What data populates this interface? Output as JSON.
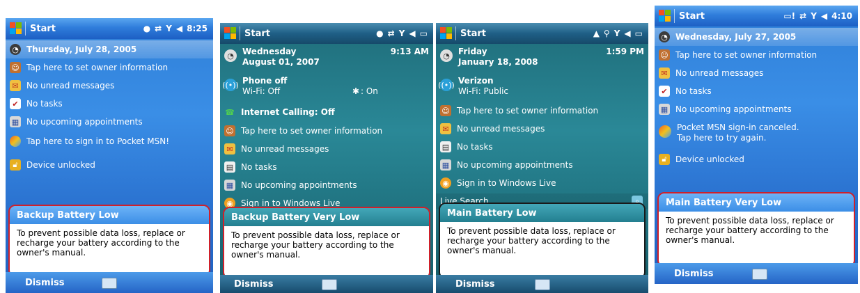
{
  "phones": [
    {
      "titlebar": {
        "start": "Start",
        "time": "8:25"
      },
      "date": "Thursday, July 28, 2005",
      "rows": [
        "Tap here to set owner information",
        "No unread messages",
        "No tasks",
        "No upcoming appointments",
        "Tap here to sign in to Pocket MSN!",
        "Device unlocked"
      ],
      "popup": {
        "title": "Backup Battery Low",
        "body": "To prevent possible data loss, replace or recharge your battery according to the owner's manual."
      },
      "softkey": "Dismiss"
    },
    {
      "titlebar": {
        "start": "Start"
      },
      "date_line1": "Wednesday",
      "date_line2": "August 01, 2007",
      "time": "9:13 AM",
      "phone_title": "Phone off",
      "phone_sub": "Wi-Fi: Off",
      "bluetooth": ": On",
      "internet": "Internet Calling: Off",
      "rows": [
        "Tap here to set owner information",
        "No unread messages",
        "No tasks",
        "No upcoming appointments",
        "Sign in to Windows Live"
      ],
      "popup": {
        "title": "Backup Battery Very Low",
        "body": "To prevent possible data loss, replace or recharge your battery according to the owner's manual."
      },
      "softkey": "Dismiss"
    },
    {
      "titlebar": {
        "start": "Start"
      },
      "date_line1": "Friday",
      "date_line2": "January 18, 2008",
      "time": "1:59 PM",
      "carrier": "Verizon",
      "wifi": "Wi-Fi: Public",
      "rows": [
        "Tap here to set owner information",
        "No unread messages",
        "No tasks",
        "No upcoming appointments",
        "Sign in to Windows Live"
      ],
      "search": "Live Search",
      "popup": {
        "title": "Main Battery Low",
        "body": "To prevent possible data loss, replace or recharge your battery according to the owner's manual."
      },
      "softkey": "Dismiss"
    },
    {
      "titlebar": {
        "start": "Start",
        "time": "4:10"
      },
      "date": "Wednesday, July 27, 2005",
      "rows": [
        "Tap here to set owner information",
        "No unread messages",
        "No tasks",
        "No upcoming appointments"
      ],
      "msn_line1": "Pocket MSN sign-in canceled.",
      "msn_line2": "Tap here to try again.",
      "device": "Device unlocked",
      "popup": {
        "title": "Main Battery Very Low",
        "body": "To prevent possible data loss, replace or recharge your battery according to the owner's manual."
      },
      "softkey": "Dismiss"
    }
  ]
}
